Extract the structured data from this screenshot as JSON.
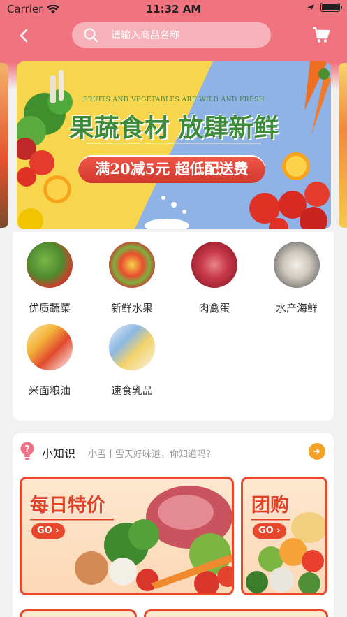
{
  "status_bar": {
    "carrier": "Carrier",
    "time": "11:32 AM"
  },
  "search": {
    "placeholder": "请输入商品名称"
  },
  "banner": {
    "subtitle": "FRUITS AND VEGETABLES ARE WILD AND FRESH",
    "title": "果蔬食材 放肆新鲜",
    "promo": "满20减5元  超低配送费"
  },
  "categories": [
    {
      "label": "优质蔬菜",
      "icon": "vegetables-icon"
    },
    {
      "label": "新鲜水果",
      "icon": "fruits-icon"
    },
    {
      "label": "肉禽蛋",
      "icon": "meat-icon"
    },
    {
      "label": "水产海鲜",
      "icon": "seafood-icon"
    },
    {
      "label": "米面粮油",
      "icon": "grain-oil-icon"
    },
    {
      "label": "速食乳品",
      "icon": "dairy-icon"
    }
  ],
  "knowledge": {
    "title": "小知识",
    "text": "小雪丨雪天好味道，你知道吗?"
  },
  "promos": {
    "daily": {
      "title": "每日特价",
      "go": "GO"
    },
    "group": {
      "title": "团购",
      "go": "GO"
    }
  },
  "colors": {
    "header": "#f07480",
    "accent": "#e8472c",
    "go_button": "#f4a326"
  }
}
